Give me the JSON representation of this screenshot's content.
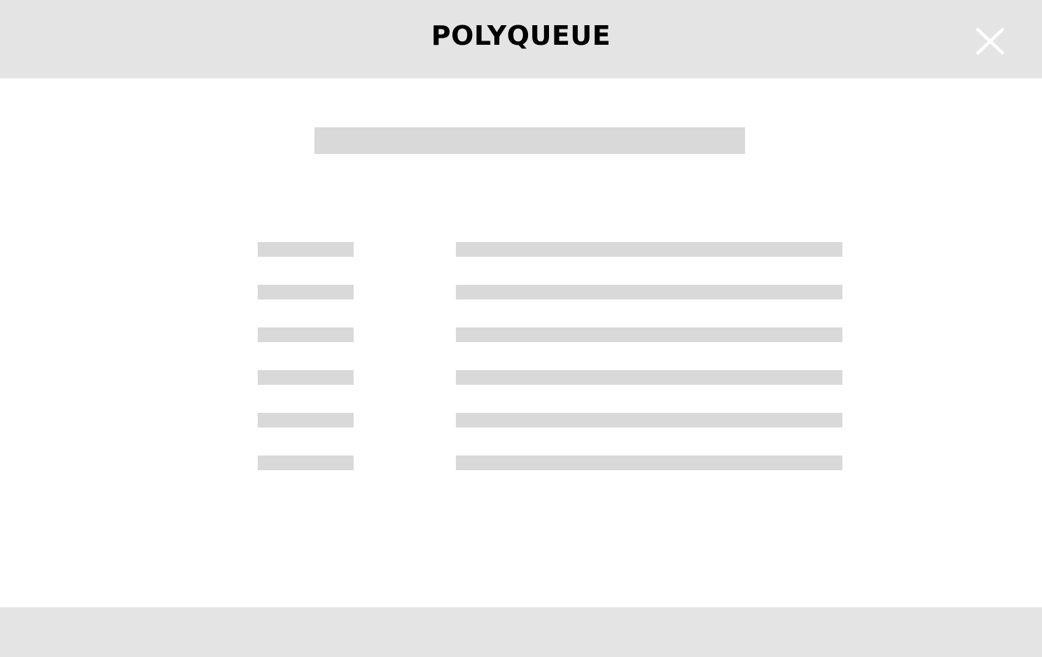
{
  "header": {
    "title": "POLYQUEUE",
    "close_icon": "close-icon",
    "background": "#e4e4e4",
    "icon_color": "#ffffff"
  },
  "main": {
    "skeleton_color": "#d9d9d9",
    "title_placeholder": "loading-placeholder",
    "rows": [
      {
        "label": "loading-placeholder",
        "value": "loading-placeholder"
      },
      {
        "label": "loading-placeholder",
        "value": "loading-placeholder"
      },
      {
        "label": "loading-placeholder",
        "value": "loading-placeholder"
      },
      {
        "label": "loading-placeholder",
        "value": "loading-placeholder"
      },
      {
        "label": "loading-placeholder",
        "value": "loading-placeholder"
      },
      {
        "label": "loading-placeholder",
        "value": "loading-placeholder"
      }
    ]
  },
  "footer": {
    "background": "#e4e4e4"
  }
}
